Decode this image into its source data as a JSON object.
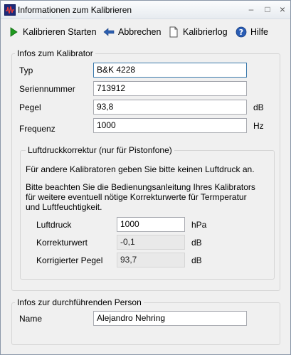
{
  "window": {
    "title": "Informationen zum Kalibrieren",
    "controls": {
      "minimize": "–",
      "maximize": "□",
      "close": "×"
    }
  },
  "toolbar": {
    "start_label": "Kalibrieren Starten",
    "cancel_label": "Abbrechen",
    "log_label": "Kalibrierlog",
    "help_label": "Hilfe"
  },
  "calibrator": {
    "group_title": "Infos zum Kalibrator",
    "type_label": "Typ",
    "type_value": "B&K 4228",
    "serial_label": "Seriennummer",
    "serial_value": "713912",
    "level_label": "Pegel",
    "level_value": "93,8",
    "level_unit": "dB",
    "freq_label": "Frequenz",
    "freq_value": "1000",
    "freq_unit": "Hz"
  },
  "pressure": {
    "group_title": "Luftdruckkorrektur (nur für Pistonfone)",
    "note1": "Für andere Kalibratoren geben Sie bitte keinen Luftdruck an.",
    "note2_line1": "Bitte beachten Sie die Bedienungsanleitung Ihres Kalibrators",
    "note2_line2": " für weitere eventuell nötige Korrekturwerte für Termperatur",
    "note2_line3": "und Luftfeuchtigkeit.",
    "pressure_label": "Luftdruck",
    "pressure_value": "1000",
    "pressure_unit": "hPa",
    "correction_label": "Korrekturwert",
    "correction_value": "-0,1",
    "correction_unit": "dB",
    "corrected_label": "Korrigierter Pegel",
    "corrected_value": "93,7",
    "corrected_unit": "dB"
  },
  "person": {
    "group_title": "Infos zur durchführenden Person",
    "name_label": "Name",
    "name_value": "Alejandro Nehring"
  },
  "colors": {
    "accent": "#3d7bad",
    "play_green": "#1f9a1f",
    "cancel_blue": "#2c5fb0",
    "help_blue": "#2a5db5"
  },
  "icons": [
    "app-waveform-icon",
    "play-icon",
    "arrow-left-icon",
    "document-icon",
    "help-icon"
  ]
}
